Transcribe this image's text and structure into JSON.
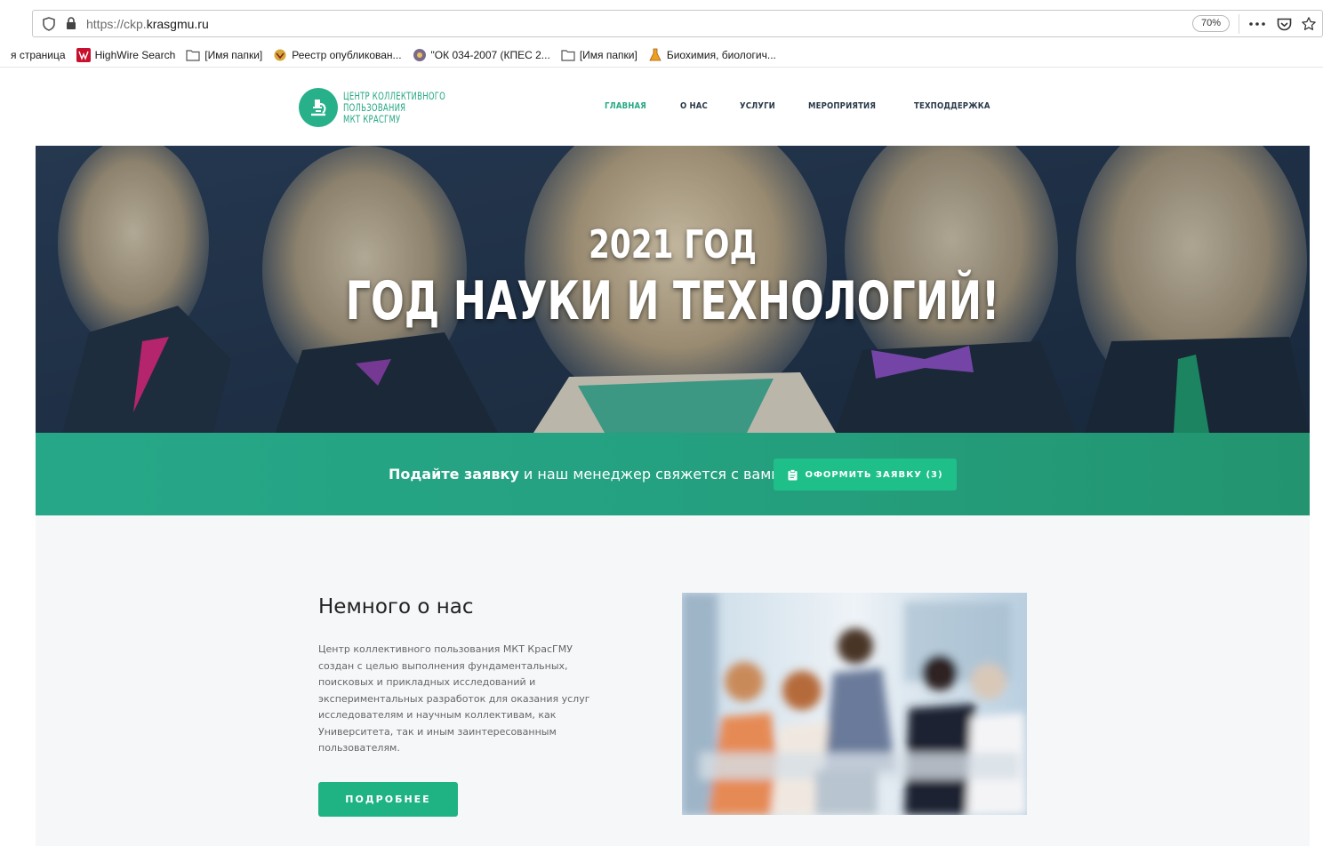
{
  "browser": {
    "url_scheme": "https://ckp.",
    "url_domain": "krasgmu.ru",
    "zoom": "70%",
    "bookmarks": [
      {
        "label": "я страница",
        "icon": "none"
      },
      {
        "label": "HighWire Search",
        "icon": "highwire-icon"
      },
      {
        "label": "[Имя папки]",
        "icon": "folder-icon"
      },
      {
        "label": "Реестр опубликован...",
        "icon": "emblem-icon"
      },
      {
        "label": "\"ОК 034-2007 (КПЕС 2...",
        "icon": "globe-icon"
      },
      {
        "label": "[Имя папки]",
        "icon": "folder-icon"
      },
      {
        "label": "Биохимия, биологич...",
        "icon": "flask-icon"
      }
    ]
  },
  "site": {
    "logo_line1": "ЦЕНТР КОЛЛЕКТИВНОГО",
    "logo_line2": "ПОЛЬЗОВАНИЯ",
    "logo_line3": "МКТ КРАСГМУ",
    "nav": [
      "ГЛАВНАЯ",
      "О НАС",
      "УСЛУГИ",
      "МЕРОПРИЯТИЯ",
      "ТЕХПОДДЕРЖКА"
    ],
    "colors": {
      "accent": "#27a884",
      "button": "#1fb384",
      "nav_text": "#2a3a4a"
    }
  },
  "hero": {
    "year_line": "2021 ГОД",
    "motto_line": "ГОД НАУКИ И ТЕХНОЛОГИЙ!"
  },
  "cta": {
    "bold_text": "Подайте заявку",
    "rest_text": " и наш менеджер свяжется с вами",
    "button_label": "ОФОРМИТЬ ЗАЯВКУ (3)"
  },
  "about": {
    "title": "Немного о нас",
    "text": "Центр коллективного пользования МКТ КрасГМУ создан с целью выполнения фундаментальных, поисковых и прикладных исследований и экспериментальных разработок для оказания услуг исследователям и научным коллективам, как Университета, так и иным заинтересованным пользователям.",
    "button_label": "ПОДРОБНЕЕ"
  }
}
